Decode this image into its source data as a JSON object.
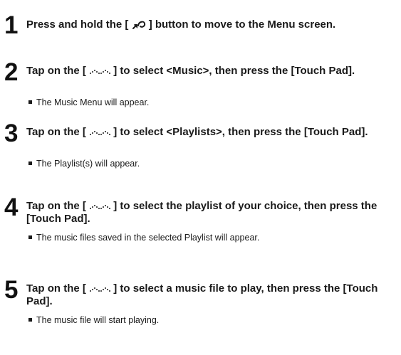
{
  "steps": [
    {
      "number": "1",
      "text_before": "Press and hold the [ ",
      "icon": "back-icon",
      "text_after": " ] button to move to the Menu screen.",
      "note": ""
    },
    {
      "number": "2",
      "text_before": "Tap on the [ ",
      "icon": "touch-strip-icon",
      "text_after": " ] to select <Music>, then press the [Touch Pad].",
      "note": "The Music Menu will appear."
    },
    {
      "number": "3",
      "text_before": "Tap on the [ ",
      "icon": "touch-strip-icon",
      "text_after": " ] to select <Playlists>, then press the [Touch Pad].",
      "note": "The Playlist(s) will appear."
    },
    {
      "number": "4",
      "text_before": "Tap on the [ ",
      "icon": "touch-strip-icon",
      "text_after": " ] to select the playlist of your choice, then press the [Touch Pad].",
      "note": "The music files saved in the selected Playlist will appear."
    },
    {
      "number": "5",
      "text_before": "Tap on the [ ",
      "icon": "touch-strip-icon",
      "text_after": " ] to select a music file to play, then press the [Touch Pad].",
      "note": "The music file will start playing."
    }
  ]
}
